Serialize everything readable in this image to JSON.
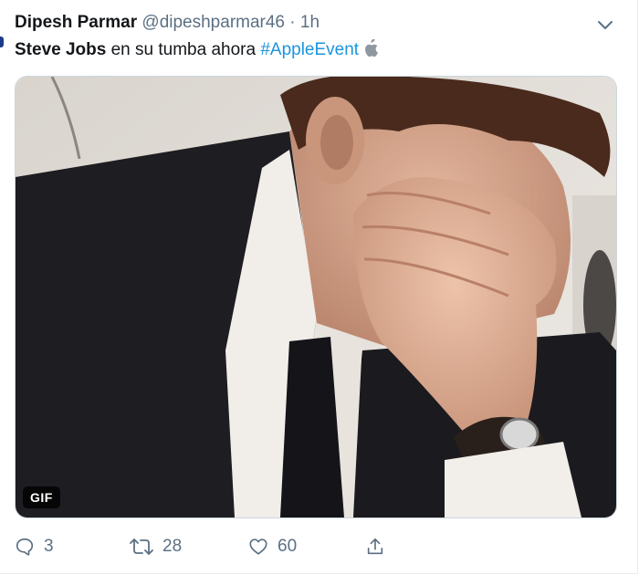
{
  "tweet": {
    "author_name": "Dipesh Parmar",
    "handle": "@dipeshparmar46",
    "separator": "·",
    "time": "1h",
    "text_bold": "Steve Jobs",
    "text_rest": " en su tumba ahora ",
    "hashtag": "#AppleEvent",
    "media_badge": "GIF"
  },
  "actions": {
    "replies": "3",
    "retweets": "28",
    "likes": "60"
  },
  "icons": [
    "chevron-down-icon",
    "apple-logo-icon",
    "reply-icon",
    "retweet-icon",
    "like-icon",
    "share-icon"
  ],
  "colors": {
    "hashtag": "#1b95e0",
    "secondary_text": "#5b7083"
  }
}
